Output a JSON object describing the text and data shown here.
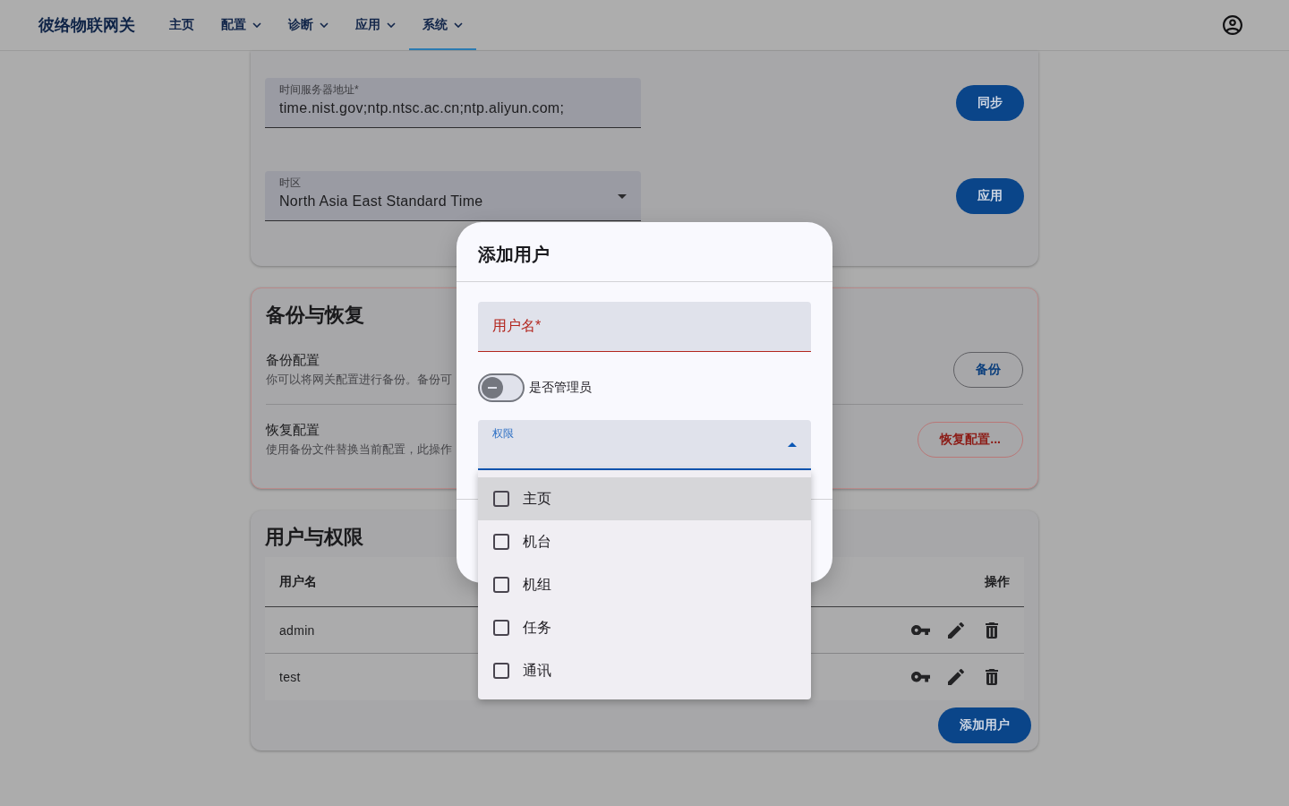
{
  "navbar": {
    "brand": "彼络物联网关",
    "items": [
      {
        "label": "主页",
        "selected": false,
        "dropdown": false
      },
      {
        "label": "配置",
        "selected": false,
        "dropdown": true
      },
      {
        "label": "诊断",
        "selected": false,
        "dropdown": true
      },
      {
        "label": "应用",
        "selected": false,
        "dropdown": true
      },
      {
        "label": "系统",
        "selected": true,
        "dropdown": true
      }
    ]
  },
  "time_settings": {
    "rows": [
      {
        "kind": "text",
        "label": "时间服务器地址*",
        "value": "time.nist.gov;ntp.ntsc.ac.cn;ntp.aliyun.com;",
        "button": "同步"
      },
      {
        "kind": "select",
        "label": "时区",
        "value": "North Asia East Standard Time",
        "button": "应用"
      }
    ]
  },
  "backup_restore": {
    "title": "备份与恢复",
    "rows": [
      {
        "title": "备份配置",
        "description": "你可以将网关配置进行备份。备份可",
        "button": "备份",
        "danger": false
      },
      {
        "title": "恢复配置",
        "description": "使用备份文件替换当前配置，此操作",
        "button": "恢复配置...",
        "danger": true
      }
    ]
  },
  "users": {
    "title": "用户与权限",
    "columns": [
      "用户名",
      "操作"
    ],
    "rows": [
      {
        "username": "admin"
      },
      {
        "username": "test"
      }
    ],
    "add_button": "添加用户"
  },
  "dialog": {
    "title": "添加用户",
    "username_field": {
      "label": "用户名*",
      "error": true
    },
    "admin_toggle": {
      "label": "是否管理员",
      "on": false
    },
    "permissions": {
      "label": "权限",
      "focused": true,
      "expanded": true,
      "options": [
        {
          "label": "主页",
          "checked": false,
          "highlighted": true
        },
        {
          "label": "机台",
          "checked": false,
          "highlighted": false
        },
        {
          "label": "机组",
          "checked": false,
          "highlighted": false
        },
        {
          "label": "任务",
          "checked": false,
          "highlighted": false
        },
        {
          "label": "通讯",
          "checked": false,
          "highlighted": false
        }
      ]
    }
  }
}
